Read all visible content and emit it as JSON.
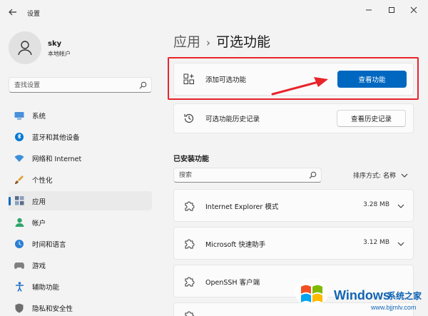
{
  "window": {
    "title": "设置",
    "controls": [
      "minimize-icon",
      "maximize-icon",
      "close-icon"
    ]
  },
  "account": {
    "name": "sky",
    "type": "本地帐户"
  },
  "sidebar": {
    "search_placeholder": "查找设置",
    "items": [
      {
        "label": "系统",
        "icon": "system-icon",
        "color": "#4a90d9"
      },
      {
        "label": "蓝牙和其他设备",
        "icon": "bluetooth-icon",
        "color": "#0078d4"
      },
      {
        "label": "网络和 Internet",
        "icon": "network-icon",
        "color": "#3d8fd8"
      },
      {
        "label": "个性化",
        "icon": "personalization-icon",
        "color": "#e2a23c"
      },
      {
        "label": "应用",
        "icon": "apps-icon",
        "color": "#5a6e8a",
        "active": true
      },
      {
        "label": "帐户",
        "icon": "accounts-icon",
        "color": "#2ea56b"
      },
      {
        "label": "时间和语言",
        "icon": "time-language-icon",
        "color": "#2b7fd6"
      },
      {
        "label": "游戏",
        "icon": "gaming-icon",
        "color": "#808080"
      },
      {
        "label": "辅助功能",
        "icon": "accessibility-icon",
        "color": "#1f6fc9"
      },
      {
        "label": "隐私和安全性",
        "icon": "privacy-icon",
        "color": "#6e6e6e"
      }
    ]
  },
  "breadcrumb": {
    "parent": "应用",
    "separator": "›",
    "current": "可选功能"
  },
  "add_feature": {
    "label": "添加可选功能",
    "button": "查看功能"
  },
  "history": {
    "label": "可选功能历史记录",
    "button": "查看历史记录"
  },
  "installed": {
    "title": "已安装功能",
    "search_placeholder": "搜索",
    "sort_label": "排序方式:",
    "sort_value": "名称",
    "features": [
      {
        "name": "Internet Explorer 模式",
        "size": "3.28 MB"
      },
      {
        "name": "Microsoft 快速助手",
        "size": "3.12 MB"
      },
      {
        "name": "OpenSSH 客户端",
        "size": ""
      }
    ]
  },
  "watermark": {
    "brand": "Windows",
    "site_name": "系统之家",
    "url": "www.bjjmlv.com"
  },
  "colors": {
    "accent": "#0067c0",
    "highlight": "#e8242b"
  }
}
